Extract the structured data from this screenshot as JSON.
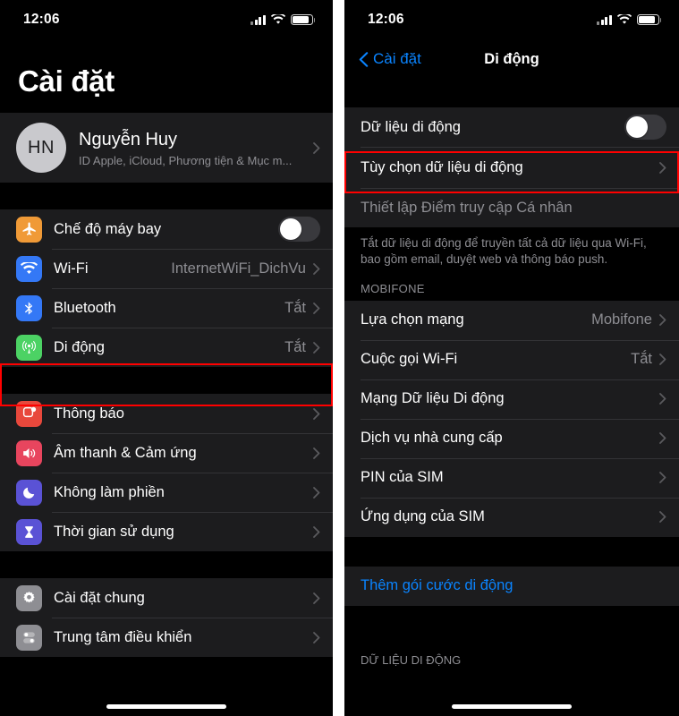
{
  "left_phone": {
    "status_bar": {
      "time": "12:06",
      "signal_icon": "cellular-bars-icon",
      "wifi_icon": "wifi-icon",
      "battery_icon": "battery-icon"
    },
    "title": "Cài đặt",
    "profile": {
      "initials": "HN",
      "name": "Nguyễn Huy",
      "subtitle": "ID Apple, iCloud, Phương tiện & Mục m..."
    },
    "groups": [
      {
        "items": [
          {
            "label": "Chế độ máy bay",
            "icon": "airplane-icon",
            "icon_color": "#f09a37",
            "control": "toggle",
            "toggle_on": false
          },
          {
            "label": "Wi-Fi",
            "icon": "wifi-icon",
            "icon_color": "#3478f6",
            "value": "InternetWiFi_DichVu",
            "control": "chevron"
          },
          {
            "label": "Bluetooth",
            "icon": "bluetooth-icon",
            "icon_color": "#3478f6",
            "value": "Tắt",
            "control": "chevron"
          },
          {
            "label": "Di động",
            "icon": "cellular-icon",
            "icon_color": "#4cd264",
            "value": "Tắt",
            "control": "chevron",
            "highlighted": true
          }
        ]
      },
      {
        "items": [
          {
            "label": "Thông báo",
            "icon": "notifications-icon",
            "icon_color": "#e8483c",
            "control": "chevron"
          },
          {
            "label": "Âm thanh & Cảm ứng",
            "icon": "sound-icon",
            "icon_color": "#e8455e",
            "control": "chevron"
          },
          {
            "label": "Không làm phiền",
            "icon": "moon-icon",
            "icon_color": "#5a52d5",
            "control": "chevron"
          },
          {
            "label": "Thời gian sử dụng",
            "icon": "hourglass-icon",
            "icon_color": "#5a52d5",
            "control": "chevron"
          }
        ]
      },
      {
        "items": [
          {
            "label": "Cài đặt chung",
            "icon": "gear-icon",
            "icon_color": "#8e8e93",
            "control": "chevron"
          },
          {
            "label": "Trung tâm điều khiển",
            "icon": "control-center-icon",
            "icon_color": "#8e8e93",
            "control": "chevron"
          }
        ]
      }
    ]
  },
  "right_phone": {
    "status_bar": {
      "time": "12:06",
      "signal_icon": "cellular-bars-icon",
      "wifi_icon": "wifi-icon",
      "battery_icon": "battery-icon"
    },
    "nav": {
      "back_label": "Cài đặt",
      "title": "Di động"
    },
    "rows": {
      "mobile_data": {
        "label": "Dữ liệu di động",
        "toggle_on": false
      },
      "data_options": {
        "label": "Tùy chọn dữ liệu di động",
        "highlighted": true
      },
      "hotspot": {
        "label": "Thiết lập Điểm truy cập Cá nhân",
        "disabled": true
      }
    },
    "footer_note": "Tắt dữ liệu di động để truyền tất cả dữ liệu qua Wi-Fi, bao gồm email, duyệt web và thông báo push.",
    "carrier_section": {
      "header": "MOBIFONE",
      "items": [
        {
          "label": "Lựa chọn mạng",
          "value": "Mobifone"
        },
        {
          "label": "Cuộc gọi Wi-Fi",
          "value": "Tắt"
        },
        {
          "label": "Mạng Dữ liệu Di động",
          "value": ""
        },
        {
          "label": "Dịch vụ nhà cung cấp",
          "value": ""
        },
        {
          "label": "PIN của SIM",
          "value": ""
        },
        {
          "label": "Ứng dụng của SIM",
          "value": ""
        }
      ]
    },
    "add_plan": {
      "label": "Thêm gói cước di động"
    },
    "bottom_header": "DỮ LIỆU DI ĐỘNG"
  },
  "colors": {
    "highlight": "#ff0000",
    "accent": "#0a84ff",
    "group_bg": "#1c1c1e",
    "secondary_text": "#8e8e93"
  }
}
